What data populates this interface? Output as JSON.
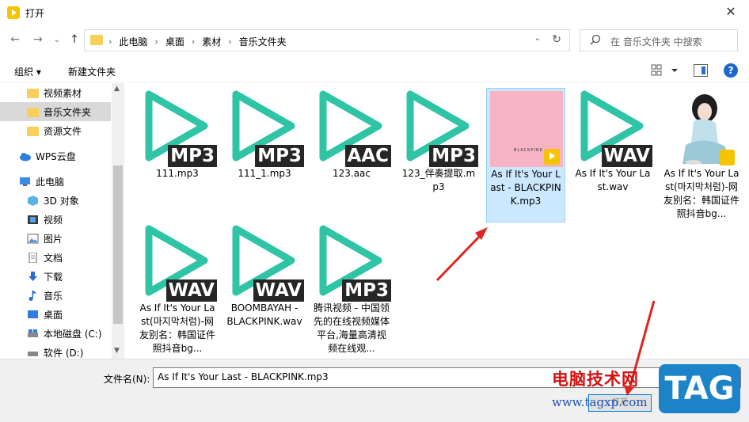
{
  "window": {
    "title": "打开",
    "close_glyph": "✕"
  },
  "nav": {
    "back_glyph": "←",
    "forward_glyph": "→",
    "recent_glyph": "⌄",
    "up_glyph": "↑",
    "breadcrumb": [
      "此电脑",
      "桌面",
      "素材",
      "音乐文件夹"
    ],
    "sep_glyph": "›",
    "dropdown_glyph": "⌄",
    "refresh_glyph": "↻"
  },
  "search": {
    "placeholder": "在 音乐文件夹 中搜索",
    "icon": "search-icon"
  },
  "toolbar": {
    "organize_label": "组织 ▾",
    "new_folder_label": "新建文件夹",
    "help_label": "?"
  },
  "sidebar": {
    "items": [
      {
        "label": "视频素材",
        "icon": "folder-icon",
        "selected": false
      },
      {
        "label": "音乐文件夹",
        "icon": "folder-icon",
        "selected": true
      },
      {
        "label": "资源文件",
        "icon": "folder-icon",
        "selected": false
      },
      {
        "label": "WPS云盘",
        "icon": "cloud-icon",
        "selected": false
      },
      {
        "label": "此电脑",
        "icon": "computer-icon",
        "selected": false
      },
      {
        "label": "3D 对象",
        "icon": "cube-icon",
        "selected": false
      },
      {
        "label": "视频",
        "icon": "video-icon",
        "selected": false
      },
      {
        "label": "图片",
        "icon": "picture-icon",
        "selected": false
      },
      {
        "label": "文档",
        "icon": "document-icon",
        "selected": false
      },
      {
        "label": "下载",
        "icon": "download-icon",
        "selected": false
      },
      {
        "label": "音乐",
        "icon": "music-icon",
        "selected": false
      },
      {
        "label": "桌面",
        "icon": "desktop-icon",
        "selected": false
      },
      {
        "label": "本地磁盘 (C:)",
        "icon": "drive-icon",
        "selected": false
      },
      {
        "label": "软件 (D:)",
        "icon": "drive-icon",
        "selected": false
      }
    ]
  },
  "files": [
    {
      "name": "111.mp3",
      "badge": "MP3",
      "kind": "play"
    },
    {
      "name": "111_1.mp3",
      "badge": "MP3",
      "kind": "play"
    },
    {
      "name": "123.aac",
      "badge": "AAC",
      "kind": "play"
    },
    {
      "name": "123_伴奏提取.mp3",
      "badge": "MP3",
      "kind": "play"
    },
    {
      "name": "As If It's Your Last - BLACKPINK.mp3",
      "badge": "",
      "kind": "album-pink",
      "selected": true,
      "album_text": "BLACKPINK"
    },
    {
      "name": "As If It's Your Last.wav",
      "badge": "WAV",
      "kind": "play"
    },
    {
      "name": "As If It's Your Last(마지막처럼)-网友别名：韩国证件照抖音bg...",
      "badge": "",
      "kind": "album-girl"
    },
    {
      "name": "As If It's Your Last(마지막처럼)-网友别名：韩国证件照抖音bg...",
      "badge": "WAV",
      "kind": "play"
    },
    {
      "name": "BOOMBAYAH - BLACKPINK.wav",
      "badge": "WAV",
      "kind": "play"
    },
    {
      "name": "腾讯视频 - 中国领先的在线视频媒体平台,海量高清视频在线观...",
      "badge": "MP3",
      "kind": "play"
    }
  ],
  "bottom": {
    "filename_label": "文件名(N):",
    "filename_value": "As If It's Your Last - BLACKPINK.mp3",
    "open_label": "打开"
  },
  "watermark": {
    "site_name": "电脑技术网",
    "url": "www.tagxp.com",
    "tag": "TAG"
  },
  "colors": {
    "play_teal": "#2ec4a5",
    "badge_dark": "#262626",
    "selection": "#cce8ff",
    "arrow_red": "#e0231f",
    "accent_blue": "#0078d7"
  }
}
